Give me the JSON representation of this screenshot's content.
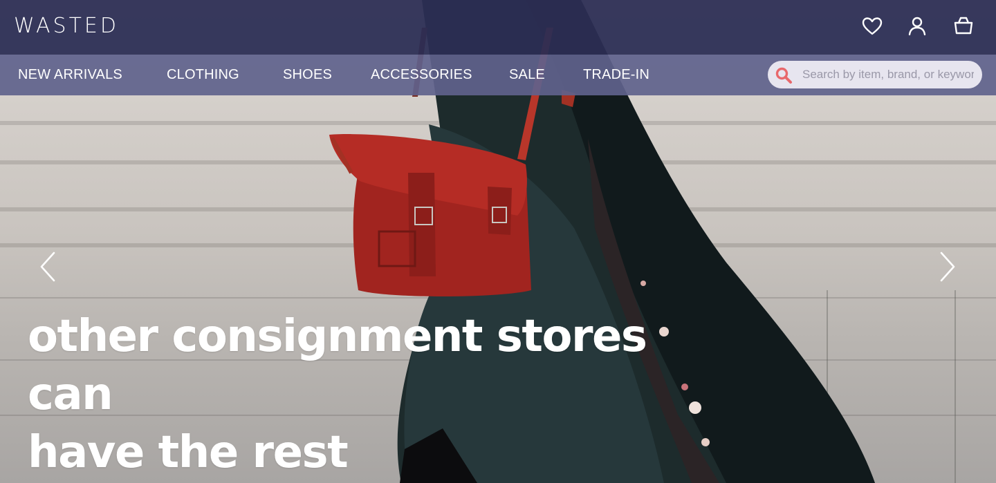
{
  "header": {
    "logo_text": "WASTED",
    "icons": [
      "heart-icon",
      "user-icon",
      "shopping-bag-icon"
    ]
  },
  "nav": {
    "items": [
      "NEW ARRIVALS",
      "CLOTHING",
      "SHOES",
      "ACCESSORIES",
      "SALE",
      "TRADE-IN"
    ],
    "search_placeholder": "Search by item, brand, or keyword"
  },
  "hero": {
    "headline_line1": "other consignment stores can",
    "headline_line2": "have the rest"
  },
  "colors": {
    "header_bg": "#2c2e54",
    "nav_bg": "#60628c",
    "search_icon": "#e8686c",
    "text": "#ffffff"
  }
}
